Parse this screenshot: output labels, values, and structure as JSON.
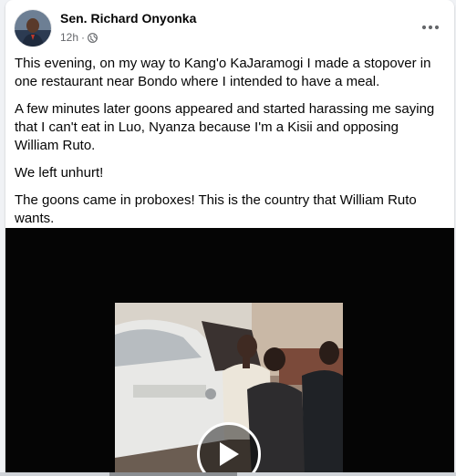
{
  "post": {
    "author": "Sen. Richard Onyonka",
    "timestamp": "12h",
    "separator": "·",
    "privacy_icon": "globe-icon",
    "more_icon": "ellipsis-icon",
    "paragraphs": [
      "This evening,  on my way to Kang'o KaJaramogi I made a stopover in one restaurant near Bondo where I intended to have a meal.",
      "A few minutes later goons appeared and started harassing me saying that I can't eat in Luo, Nyanza because I'm a Kisii and opposing William Ruto.",
      "We left unhurt!",
      "The goons came in proboxes! This is the country that William Ruto wants."
    ],
    "video": {
      "play_icon": "play-icon"
    }
  },
  "colors": {
    "text_primary": "#050505",
    "text_secondary": "#65676b",
    "video_bg": "#050505",
    "card_bg": "#ffffff",
    "page_bg": "#f0f2f5"
  }
}
